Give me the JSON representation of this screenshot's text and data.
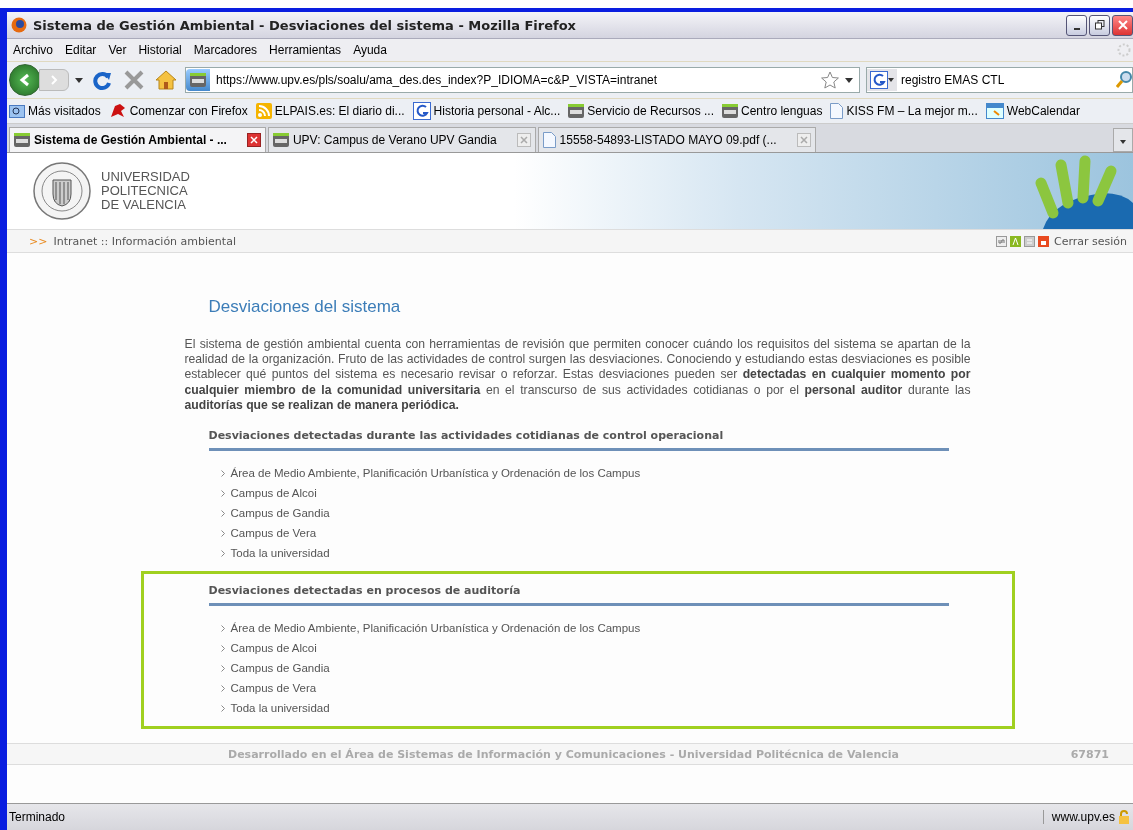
{
  "window": {
    "title": "Sistema de Gestión Ambiental - Desviaciones del sistema - Mozilla Firefox"
  },
  "menu": [
    "Archivo",
    "Editar",
    "Ver",
    "Historial",
    "Marcadores",
    "Herramientas",
    "Ayuda"
  ],
  "address_bar": {
    "value": "https://www.upv.es/pls/soalu/ama_des.des_index?P_IDIOMA=c&P_VISTA=intranet"
  },
  "search": {
    "value": "registro EMAS CTL"
  },
  "bookmarks": [
    {
      "label": "Más visitados",
      "kind": "folder"
    },
    {
      "label": "Comenzar con Firefox",
      "kind": "firefox"
    },
    {
      "label": "ELPAIS.es: El diario di...",
      "kind": "rss"
    },
    {
      "label": "Historia personal - Alc...",
      "kind": "google"
    },
    {
      "label": "Servicio de Recursos ...",
      "kind": "upv"
    },
    {
      "label": "Centro lenguas",
      "kind": "upv"
    },
    {
      "label": "KISS FM – La mejor m...",
      "kind": "page"
    },
    {
      "label": "WebCalendar",
      "kind": "calendar"
    }
  ],
  "tabs": [
    {
      "label": "Sistema de Gestión Ambiental - ...",
      "kind": "upv",
      "selected": true
    },
    {
      "label": "UPV: Campus de Verano UPV Gandia",
      "kind": "upv",
      "selected": false
    },
    {
      "label": "15558-54893-LISTADO MAYO 09.pdf (...",
      "kind": "page",
      "selected": false
    }
  ],
  "site_logo": {
    "lines": [
      "UNIVERSIDAD",
      "POLITECNICA",
      "DE VALENCIA"
    ]
  },
  "breadcrumb": {
    "marker": ">>",
    "text": "Intranet :: Información ambiental"
  },
  "logout": "Cerrar sesión",
  "page_title": "Desviaciones del sistema",
  "intro": "El sistema de gestión ambiental cuenta con herramientas de revisión que permiten conocer cuándo los requisitos del sistema se apartan de la realidad de la organización. Fruto de las actividades de control surgen las desviaciones. Conociendo y estudiando estas desviaciones es posible establecer qué puntos del sistema es necesario revisar o reforzar. Estas desviaciones pueden ser **detectadas en cualquier momento por cualquier miembro de la comunidad universitaria** en el transcurso de sus actividades cotidianas o por el **personal auditor** durante las **auditorías que se realizan de manera periódica.**",
  "sections": [
    {
      "title": "Desviaciones detectadas durante las actividades cotidianas de control operacional",
      "links": [
        "Área de Medio Ambiente, Planificación Urbanística y Ordenación de los Campus",
        "Campus de Alcoi",
        "Campus de Gandia",
        "Campus de Vera",
        "Toda la universidad"
      ]
    },
    {
      "title": "Desviaciones detectadas en procesos de auditoría",
      "highlighted": true,
      "links": [
        "Área de Medio Ambiente, Planificación Urbanística y Ordenación de los Campus",
        "Campus de Alcoi",
        "Campus de Gandia",
        "Campus de Vera",
        "Toda la universidad"
      ]
    }
  ],
  "footer": {
    "text": "Desarrollado en el Área de Sistemas de Información y Comunicaciones  - Universidad Politécnica de Valencia",
    "counter": "67871"
  },
  "status_bar": {
    "text": "Terminado",
    "domain": "www.upv.es"
  }
}
